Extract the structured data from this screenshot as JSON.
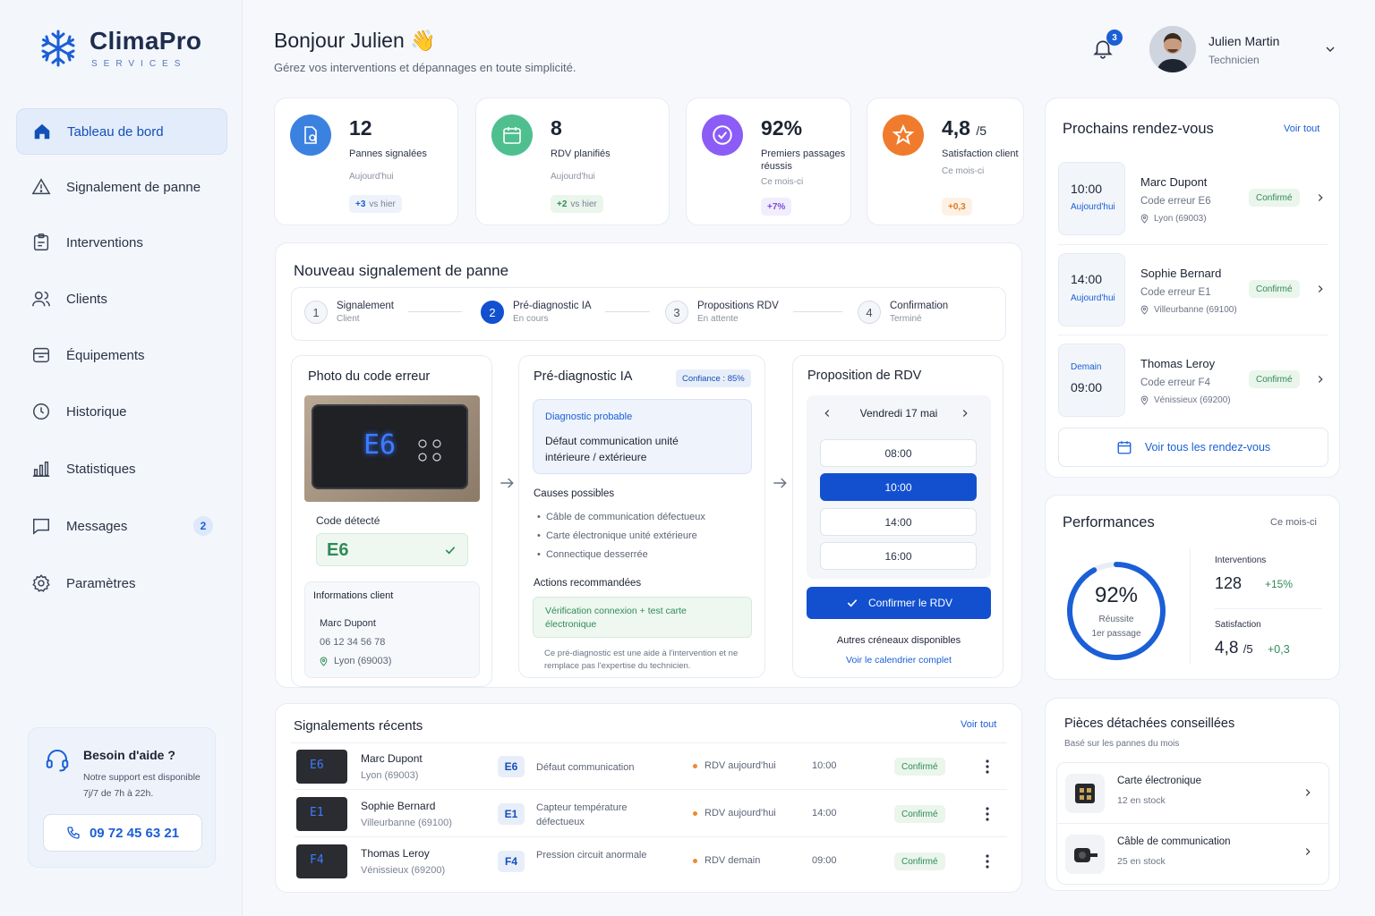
{
  "brand": {
    "name": "ClimaPro",
    "sub": "SERVICES"
  },
  "nav": [
    {
      "label": "Tableau de bord",
      "icon": "home-icon",
      "active": true
    },
    {
      "label": "Signalement de panne",
      "icon": "warning-icon"
    },
    {
      "label": "Interventions",
      "icon": "clipboard-icon"
    },
    {
      "label": "Clients",
      "icon": "users-icon"
    },
    {
      "label": "Équipements",
      "icon": "box-icon"
    },
    {
      "label": "Historique",
      "icon": "clock-icon"
    },
    {
      "label": "Statistiques",
      "icon": "bar-chart-icon"
    },
    {
      "label": "Messages",
      "icon": "message-icon",
      "badge": "2"
    },
    {
      "label": "Paramètres",
      "icon": "gear-icon"
    }
  ],
  "help": {
    "title": "Besoin d'aide ?",
    "text": "Notre support est disponible 7j/7 de 7h à 22h.",
    "phone": "09 72 45 63 21"
  },
  "header": {
    "greeting": "Bonjour Julien 👋",
    "subtitle": "Gérez vos interventions et dépannages en toute simplicité.",
    "notif_count": "3",
    "user_name": "Julien Martin",
    "user_role": "Technicien"
  },
  "stats": [
    {
      "value": "12",
      "label": "Pannes signalées",
      "period": "Aujourd'hui",
      "delta": "+3",
      "delta_suffix": "vs hier",
      "color": "#3b82e0"
    },
    {
      "value": "8",
      "label": "RDV planifiés",
      "period": "Aujourd'hui",
      "delta": "+2",
      "delta_suffix": "vs hier",
      "color": "#4fbf8f"
    },
    {
      "value": "92%",
      "label": "Premiers passages réussis",
      "period": "Ce mois-ci",
      "delta": "+7%",
      "color": "#8b5cf6"
    },
    {
      "value": "4,8",
      "value_suffix": "/5",
      "label": "Satisfaction client",
      "period": "Ce mois-ci",
      "delta": "+0,3",
      "color": "#f07b2c"
    }
  ],
  "report": {
    "title": "Nouveau signalement de panne",
    "steps": [
      {
        "num": "1",
        "label": "Signalement",
        "status": "Client"
      },
      {
        "num": "2",
        "label": "Pré-diagnostic IA",
        "status": "En cours"
      },
      {
        "num": "3",
        "label": "Propositions RDV",
        "status": "En attente"
      },
      {
        "num": "4",
        "label": "Confirmation",
        "status": "Terminé"
      }
    ],
    "photo": {
      "title": "Photo du code erreur",
      "screen_code": "E6",
      "detected_label": "Code détecté",
      "detected_code": "E6",
      "client_title": "Informations client",
      "client_name": "Marc Dupont",
      "client_phone": "06 12 34 56 78",
      "client_city": "Lyon (69003)"
    },
    "diag": {
      "title": "Pré-diagnostic IA",
      "confidence": "Confiance : 85%",
      "probable_label": "Diagnostic probable",
      "probable_text": "Défaut communication unité intérieure / extérieure",
      "causes_title": "Causes possibles",
      "causes": [
        "Câble de communication défectueux",
        "Carte électronique unité extérieure",
        "Connectique desserrée"
      ],
      "actions_title": "Actions recommandées",
      "action_text": "Vérification connexion + test carte électronique",
      "disclaimer": "Ce pré-diagnostic est une aide à l'intervention et ne remplace pas l'expertise du technicien."
    },
    "booking": {
      "title": "Proposition de RDV",
      "date": "Vendredi 17 mai",
      "slots": [
        "08:00",
        "10:00",
        "14:00",
        "16:00"
      ],
      "confirm": "Confirmer le RDV",
      "other": "Autres créneaux disponibles",
      "calendar_link": "Voir le calendrier complet"
    }
  },
  "recent": {
    "title": "Signalements récents",
    "see_all": "Voir tout",
    "rows": [
      {
        "thumb": "E6",
        "name": "Marc Dupont",
        "city": "Lyon (69003)",
        "code": "E6",
        "desc": "Défaut communication",
        "rdv": "RDV aujourd'hui",
        "time": "10:00",
        "status": "Confirmé"
      },
      {
        "thumb": "E1",
        "name": "Sophie Bernard",
        "city": "Villeurbanne (69100)",
        "code": "E1",
        "desc": "Capteur température défectueux",
        "rdv": "RDV aujourd'hui",
        "time": "14:00",
        "status": "Confirmé"
      },
      {
        "thumb": "F4",
        "name": "Thomas Leroy",
        "city": "Vénissieux (69200)",
        "code": "F4",
        "desc": "Pression circuit anormale",
        "rdv": "RDV demain",
        "time": "09:00",
        "status": "Confirmé"
      }
    ]
  },
  "upcoming": {
    "title": "Prochains rendez-vous",
    "see_all": "Voir tout",
    "items": [
      {
        "time": "10:00",
        "day": "Aujourd'hui",
        "name": "Marc Dupont",
        "code": "Code erreur E6",
        "city": "Lyon (69003)",
        "status": "Confirmé"
      },
      {
        "time": "14:00",
        "day": "Aujourd'hui",
        "name": "Sophie Bernard",
        "code": "Code erreur E1",
        "city": "Villeurbanne (69100)",
        "status": "Confirmé"
      },
      {
        "time": "09:00",
        "day": "Demain",
        "name": "Thomas Leroy",
        "code": "Code erreur F4",
        "city": "Vénissieux (69200)",
        "status": "Confirmé"
      }
    ],
    "all_link": "Voir tous les rendez-vous"
  },
  "performance": {
    "title": "Performances",
    "period": "Ce mois-ci",
    "ring_value": "92%",
    "ring_fraction": 0.92,
    "ring_label1": "Réussite",
    "ring_label2": "1er passage",
    "interventions_label": "Interventions",
    "interventions_value": "128",
    "interventions_delta": "+15%",
    "satisfaction_label": "Satisfaction",
    "satisfaction_value": "4,8",
    "satisfaction_suffix": "/5",
    "satisfaction_delta": "+0,3"
  },
  "parts": {
    "title": "Pièces détachées conseillées",
    "subtitle": "Basé sur les pannes du mois",
    "items": [
      {
        "name": "Carte électronique",
        "stock": "12 en stock"
      },
      {
        "name": "Câble de communication",
        "stock": "25 en stock"
      }
    ]
  }
}
